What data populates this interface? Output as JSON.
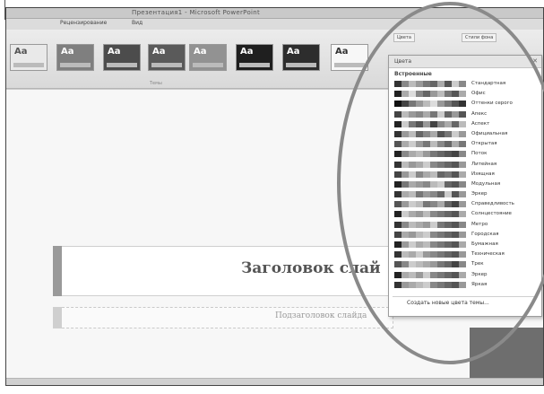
{
  "window": {
    "title": "Презентация1 - Microsoft PowerPoint"
  },
  "tabs": [
    "Рецензирование",
    "Вид"
  ],
  "ribbon": {
    "group_label": "Темы",
    "colors_button": "Цвета",
    "bg_styles_button": "Стили фона",
    "themes": [
      {
        "label": "Aa",
        "bg": "#e9e9e9",
        "fg": "#555555"
      },
      {
        "label": "Aa",
        "bg": "#7f7f7f",
        "fg": "#ffffff"
      },
      {
        "label": "Aa",
        "bg": "#4c4c4c",
        "fg": "#ffffff"
      },
      {
        "label": "Aa",
        "bg": "#5a5a5a",
        "fg": "#ffffff"
      },
      {
        "label": "Aa",
        "bg": "#929292",
        "fg": "#ffffff"
      },
      {
        "label": "Aa",
        "bg": "#1f1f1f",
        "fg": "#ffffff"
      },
      {
        "label": "Aa",
        "bg": "#2d2d2d",
        "fg": "#ffffff"
      },
      {
        "label": "Aa",
        "bg": "#f7f7f7",
        "fg": "#333333"
      }
    ]
  },
  "dropdown": {
    "section": "Встроенные",
    "items": [
      {
        "name": "Стандартная",
        "colors": [
          "#333333",
          "#888888",
          "#bbbbbb",
          "#999999",
          "#777777",
          "#666666",
          "#aaaaaa",
          "#555555",
          "#cccccc",
          "#888888"
        ]
      },
      {
        "name": "Офис",
        "colors": [
          "#222222",
          "#aaaaaa",
          "#dddddd",
          "#888888",
          "#666666",
          "#999999",
          "#bbbbbb",
          "#777777",
          "#555555",
          "#aaaaaa"
        ]
      },
      {
        "name": "Оттенки серого",
        "colors": [
          "#111111",
          "#444444",
          "#777777",
          "#999999",
          "#bbbbbb",
          "#dddddd",
          "#999999",
          "#777777",
          "#555555",
          "#333333"
        ]
      },
      {
        "name": "Апекс",
        "colors": [
          "#444444",
          "#bbbbbb",
          "#999999",
          "#888888",
          "#aaaaaa",
          "#777777",
          "#cccccc",
          "#666666",
          "#999999",
          "#555555"
        ]
      },
      {
        "name": "Аспект",
        "colors": [
          "#222222",
          "#cccccc",
          "#777777",
          "#555555",
          "#999999",
          "#444444",
          "#888888",
          "#aaaaaa",
          "#666666",
          "#bbbbbb"
        ]
      },
      {
        "name": "Официальная",
        "colors": [
          "#333333",
          "#999999",
          "#bbbbbb",
          "#666666",
          "#888888",
          "#aaaaaa",
          "#555555",
          "#777777",
          "#cccccc",
          "#999999"
        ]
      },
      {
        "name": "Открытая",
        "colors": [
          "#555555",
          "#aaaaaa",
          "#cccccc",
          "#999999",
          "#777777",
          "#bbbbbb",
          "#888888",
          "#666666",
          "#aaaaaa",
          "#777777"
        ]
      },
      {
        "name": "Поток",
        "colors": [
          "#222222",
          "#888888",
          "#aaaaaa",
          "#bbbbbb",
          "#999999",
          "#777777",
          "#666666",
          "#555555",
          "#444444",
          "#888888"
        ]
      },
      {
        "name": "Литейная",
        "colors": [
          "#333333",
          "#bbbbbb",
          "#999999",
          "#aaaaaa",
          "#cccccc",
          "#888888",
          "#777777",
          "#666666",
          "#555555",
          "#999999"
        ]
      },
      {
        "name": "Изящная",
        "colors": [
          "#444444",
          "#999999",
          "#cccccc",
          "#888888",
          "#aaaaaa",
          "#bbbbbb",
          "#666666",
          "#777777",
          "#555555",
          "#aaaaaa"
        ]
      },
      {
        "name": "Модульная",
        "colors": [
          "#222222",
          "#777777",
          "#aaaaaa",
          "#999999",
          "#888888",
          "#bbbbbb",
          "#cccccc",
          "#666666",
          "#555555",
          "#888888"
        ]
      },
      {
        "name": "Эркер",
        "colors": [
          "#333333",
          "#aaaaaa",
          "#bbbbbb",
          "#777777",
          "#999999",
          "#888888",
          "#666666",
          "#cccccc",
          "#555555",
          "#999999"
        ]
      },
      {
        "name": "Справедливость",
        "colors": [
          "#555555",
          "#999999",
          "#cccccc",
          "#bbbbbb",
          "#777777",
          "#888888",
          "#aaaaaa",
          "#666666",
          "#444444",
          "#999999"
        ]
      },
      {
        "name": "Солнцестояние",
        "colors": [
          "#222222",
          "#cccccc",
          "#aaaaaa",
          "#999999",
          "#bbbbbb",
          "#888888",
          "#777777",
          "#666666",
          "#555555",
          "#aaaaaa"
        ]
      },
      {
        "name": "Метро",
        "colors": [
          "#333333",
          "#888888",
          "#bbbbbb",
          "#aaaaaa",
          "#999999",
          "#cccccc",
          "#777777",
          "#666666",
          "#555555",
          "#888888"
        ]
      },
      {
        "name": "Городская",
        "colors": [
          "#444444",
          "#aaaaaa",
          "#999999",
          "#bbbbbb",
          "#cccccc",
          "#888888",
          "#777777",
          "#666666",
          "#555555",
          "#999999"
        ]
      },
      {
        "name": "Бумажная",
        "colors": [
          "#222222",
          "#999999",
          "#cccccc",
          "#aaaaaa",
          "#bbbbbb",
          "#888888",
          "#777777",
          "#666666",
          "#555555",
          "#aaaaaa"
        ]
      },
      {
        "name": "Техническая",
        "colors": [
          "#333333",
          "#bbbbbb",
          "#aaaaaa",
          "#cccccc",
          "#999999",
          "#888888",
          "#777777",
          "#666666",
          "#555555",
          "#999999"
        ]
      },
      {
        "name": "Трек",
        "colors": [
          "#555555",
          "#888888",
          "#cccccc",
          "#bbbbbb",
          "#aaaaaa",
          "#999999",
          "#777777",
          "#666666",
          "#444444",
          "#888888"
        ]
      },
      {
        "name": "Эркер",
        "colors": [
          "#222222",
          "#aaaaaa",
          "#bbbbbb",
          "#999999",
          "#cccccc",
          "#888888",
          "#777777",
          "#666666",
          "#555555",
          "#aaaaaa"
        ]
      },
      {
        "name": "Яркая",
        "colors": [
          "#333333",
          "#999999",
          "#aaaaaa",
          "#bbbbbb",
          "#cccccc",
          "#888888",
          "#777777",
          "#666666",
          "#555555",
          "#999999"
        ]
      }
    ],
    "footer": "Создать новые цвета темы..."
  },
  "slide": {
    "title": "Заголовок слай",
    "subtitle": "Подзаголовок слайда"
  }
}
